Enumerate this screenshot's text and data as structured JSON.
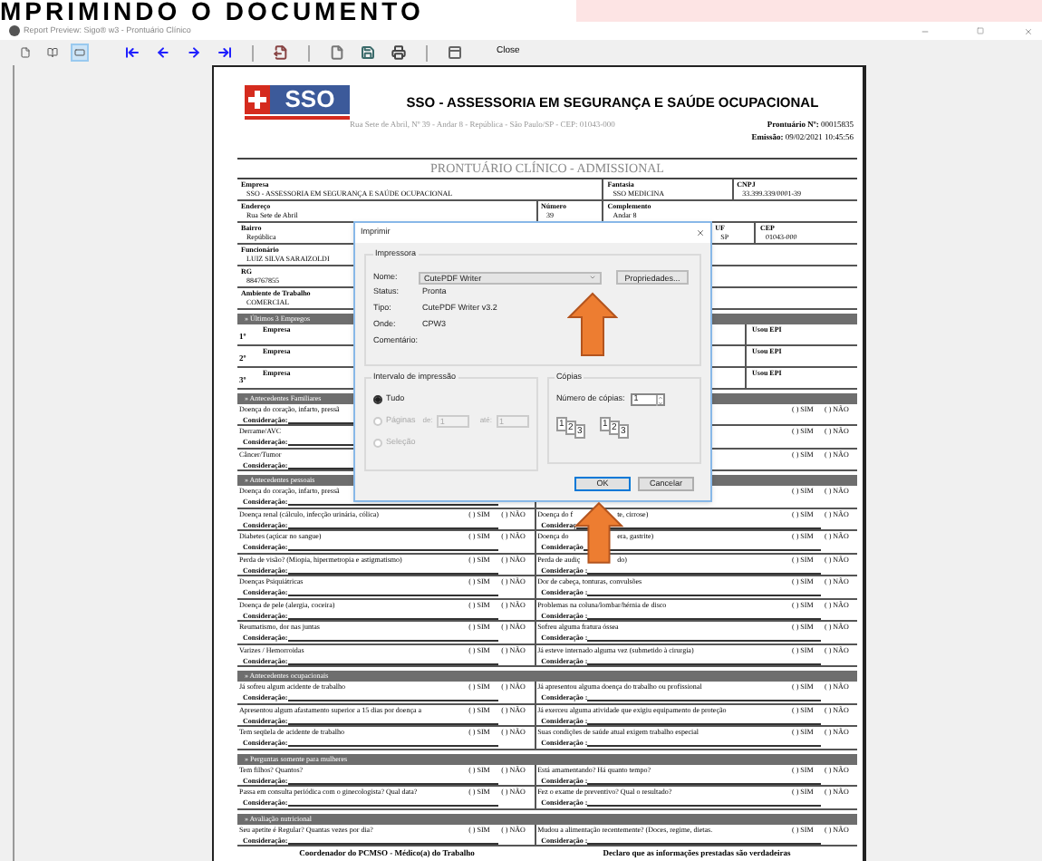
{
  "banner": {
    "text": "MPRIMINDO O DOCUMENTO"
  },
  "window": {
    "title": "Report Preview: Sigo® w3 - Prontuário Clínico"
  },
  "toolbar": {
    "view_modes": [
      {
        "kind": "one-page",
        "selected": false
      },
      {
        "kind": "two-pages",
        "selected": false
      },
      {
        "kind": "page-width",
        "selected": true
      }
    ],
    "tools": [
      {
        "kind": "first"
      },
      {
        "kind": "previous"
      },
      {
        "kind": "next"
      },
      {
        "kind": "last"
      },
      {
        "kind": "separator"
      },
      {
        "kind": "export"
      },
      {
        "kind": "separator"
      },
      {
        "kind": "new"
      },
      {
        "kind": "save"
      },
      {
        "kind": "print"
      },
      {
        "kind": "separator"
      },
      {
        "kind": "panel"
      }
    ],
    "close_label": "Close"
  },
  "document": {
    "logo_text": "SSO",
    "company_title": "SSO - ASSESSORIA EM SEGURANÇA E SAÚDE OCUPACIONAL",
    "address": "Rua Sete de Abril, Nº 39 - Andar 8 - República - São Paulo/SP - CEP: 01043-000",
    "record_label": "Prontuário Nº:",
    "record_no": "00015835",
    "issued_label": "Emissão:",
    "issued": "09/02/2021 10:45:56",
    "title": "PRONTUÁRIO CLÍNICO - ADMISSIONAL",
    "field_rows": [
      [
        {
          "label": "Empresa",
          "value": "SSO - ASSESSORIA EM SEGURANÇA E SAÚDE OCUPACIONAL"
        },
        {
          "label": "Fantasia",
          "value": "SSO MEDICINA"
        },
        {
          "label": "CNPJ",
          "value": "33.399.339/0001-39"
        }
      ],
      [
        {
          "label": "Endereço",
          "value": "Rua Sete de Abril"
        },
        {
          "label": "Número",
          "value": "39"
        },
        {
          "label": "Complemento",
          "value": "Andar 8"
        }
      ],
      [
        {
          "label": "Bairro",
          "value": "República"
        },
        {
          "label": "UF",
          "value": "SP"
        },
        {
          "label": "CEP",
          "value": "01043-000"
        }
      ],
      [
        {
          "label": "Funcionário",
          "value": "LUIZ SILVA SARAIZOLDI"
        }
      ],
      [
        {
          "label": "RG",
          "value": "884767855"
        }
      ],
      [
        {
          "label": "Ambiente de Trabalho",
          "value": "COMERCIAL"
        }
      ]
    ],
    "jobs": {
      "title": "» Últimos 3 Empregos",
      "rows": [
        {
          "index": "1º",
          "company_label": "Empresa",
          "epi_label": "Usou EPI"
        },
        {
          "index": "2º",
          "company_label": "Empresa",
          "epi_label": "Usou EPI"
        },
        {
          "index": "3º",
          "company_label": "Empresa",
          "epi_label": "Usou EPI"
        }
      ]
    },
    "sections": [
      {
        "title": "» Antecedentes Familiares",
        "rows": [
          {
            "left": {
              "question": "Doença do coração, infarto, pressã",
              "note": "Consideração:"
            },
            "right": {
              "yes": "(  ) SIM",
              "no": "(  ) NÃO"
            }
          },
          {
            "left": {
              "question": "Derrame/AVC",
              "note": "Consideração:"
            },
            "right": {
              "yes": "(  ) SIM",
              "no": "(  ) NÃO"
            }
          },
          {
            "left": {
              "question": "Câncer/Tumor",
              "note": "Consideração:"
            },
            "right": {
              "yes": "(  ) SIM",
              "no": "(  ) NÃO"
            }
          }
        ]
      },
      {
        "title": "» Antecedentes pessoais",
        "rows": [
          {
            "left": {
              "question": "Doença do coração, infarto, pressã",
              "note": "Consideração:"
            },
            "right": {
              "yes": "(  ) SIM",
              "no": "(  ) NÃO"
            }
          },
          {
            "left": {
              "question": "Doença renal (cálculo, infecção urinária, cólica)",
              "yes": "(  ) SIM",
              "no": "(  ) NÃO",
              "note": "Consideração:"
            },
            "right": {
              "question": [
                "Doença do f",
                "te, cirrose)"
              ],
              "yes": "(  ) SIM",
              "no": "(  ) NÃO",
              "note": "Consideraç"
            }
          },
          {
            "left": {
              "question": "Diabetes (açúcar no sangue)",
              "yes": "(  ) SIM",
              "no": "(  ) NÃO",
              "note": "Consideração:"
            },
            "right": {
              "question": [
                "Doença do",
                "era, gastrite)"
              ],
              "yes": "(  ) SIM",
              "no": "(  ) NÃO",
              "note": "Consideração"
            }
          },
          {
            "left": {
              "question": "Perda de visão? (Miopia, hipermetropia e astigmatismo)",
              "yes": "(  ) SIM",
              "no": "(  ) NÃO",
              "note": "Consideração:"
            },
            "right": {
              "question": [
                "Perda de audiç",
                "do)"
              ],
              "yes": "(  ) SIM",
              "no": "(  ) NÃO",
              "note": "Consideração :"
            }
          },
          {
            "left": {
              "question": "Doenças Psiquiátricas",
              "yes": "(  ) SIM",
              "no": "(  ) NÃO",
              "note": "Consideração:"
            },
            "right": {
              "question": "Dor de cabeça, tonturas, convulsões",
              "yes": "(  ) SIM",
              "no": "(  ) NÃO",
              "note": "Consideração :"
            }
          },
          {
            "left": {
              "question": "Doença de pele (alergia, coceira)",
              "yes": "(  ) SIM",
              "no": "(  ) NÃO",
              "note": "Consideração:"
            },
            "right": {
              "question": "Problemas na coluna/lombar/hérnia de disco",
              "yes": "(  ) SIM",
              "no": "(  ) NÃO",
              "note": "Consideração :"
            }
          },
          {
            "left": {
              "question": "Reumatismo, dor nas juntas",
              "yes": "(  ) SIM",
              "no": "(  ) NÃO",
              "note": "Consideração:"
            },
            "right": {
              "question": "Sofreu alguma fratura óssea",
              "yes": "(  ) SIM",
              "no": "(  ) NÃO",
              "note": "Consideração :"
            }
          },
          {
            "left": {
              "question": "Varizes / Hemorroidas",
              "yes": "(  ) SIM",
              "no": "(  ) NÃO",
              "note": "Consideração:"
            },
            "right": {
              "question": "Já esteve internado alguma vez (submetido à cirurgia)",
              "yes": "(  ) SIM",
              "no": "(  ) NÃO",
              "note": "Consideração :"
            }
          }
        ]
      },
      {
        "title": "» Antecedentes ocupacionais",
        "rows": [
          {
            "left": {
              "question": "Já sofreu algum acidente de trabalho",
              "yes": "(  ) SIM",
              "no": "(  ) NÃO",
              "note": "Consideração:"
            },
            "right": {
              "question": "Já apresentou alguma doença do trabalho ou profissional",
              "yes": "(  ) SIM",
              "no": "(  ) NÃO",
              "note": "Consideração :"
            }
          },
          {
            "left": {
              "question": "Apresentou algum afastamento superior a 15 dias por doença a",
              "yes": "(  ) SIM",
              "no": "(  ) NÃO",
              "note": "Consideração:"
            },
            "right": {
              "question": "Já exerceu alguma atividade que exigiu equipamento de proteção",
              "yes": "(  ) SIM",
              "no": "(  ) NÃO",
              "note": "Consideração :"
            }
          },
          {
            "left": {
              "question": "Tem seqüela de acidente de trabalho",
              "yes": "(  ) SIM",
              "no": "(  ) NÃO",
              "note": "Consideração:"
            },
            "right": {
              "question": "Suas condições de saúde atual exigem trabalho especial",
              "yes": "(  ) SIM",
              "no": "(  ) NÃO",
              "note": "Consideração :"
            }
          }
        ]
      },
      {
        "title": "» Perguntas somente para mulheres",
        "rows": [
          {
            "left": {
              "question": "Tem filhos? Quantos?",
              "yes": "(  ) SIM",
              "no": "(  ) NÃO",
              "note": "Consideração:"
            },
            "right": {
              "question": "Está amamentando? Há quanto tempo?",
              "yes": "(  ) SIM",
              "no": "(  ) NÃO",
              "note": "Consideração :"
            }
          },
          {
            "left": {
              "question": "Passa em consulta periódica com o ginecologista? Qual data?",
              "yes": "(  ) SIM",
              "no": "(  ) NÃO",
              "note": "Consideração:"
            },
            "right": {
              "question": "Fez o exame de preventivo? Qual o resultado?",
              "yes": "(  ) SIM",
              "no": "(  ) NÃO",
              "note": "Consideração :"
            }
          }
        ]
      },
      {
        "title": "» Avaliação nutricional",
        "rows": [
          {
            "left": {
              "question": "Seu apetite é Regular? Quantas vezes por dia?",
              "yes": "(  ) SIM",
              "no": "(  ) NÃO",
              "note": "Consideração:"
            },
            "right": {
              "question": "Mudou a alimentação recentemente? (Doces, regime, dietas.",
              "yes": "(  ) SIM",
              "no": "(  ) NÃO",
              "note": "Consideração :"
            }
          }
        ]
      }
    ],
    "footer_left": "Coordenador do PCMSO - Médico(a) do Trabalho",
    "footer_right": "Declaro que as informações prestadas são verdadeiras"
  },
  "print_dialog": {
    "title": "Imprimir",
    "printer_group": "Impressora",
    "name_label": "Nome:",
    "printer": "CutePDF Writer",
    "properties": "Propriedades...",
    "info": [
      {
        "label": "Status:",
        "value": "Pronta"
      },
      {
        "label": "Tipo:",
        "value": "CutePDF Writer v3.2"
      },
      {
        "label": "Onde:",
        "value": "CPW3"
      },
      {
        "label": "Comentário:"
      }
    ],
    "range_group": "Intervalo de impressão",
    "range_options": [
      {
        "label": "Tudo",
        "selected": true,
        "disabled": false
      },
      {
        "label": "Páginas",
        "selected": false,
        "disabled": true
      },
      {
        "label": "Seleção",
        "selected": false,
        "disabled": true
      }
    ],
    "from_label": "de:",
    "from": "1",
    "to_label": "até:",
    "to": "1",
    "copies_group": "Cópias",
    "copies_label": "Número de cópias:",
    "copies": "1",
    "collate_icons": [
      [
        "1",
        "2",
        "3"
      ],
      [
        "1",
        "2",
        "3"
      ]
    ],
    "ok": "OK",
    "cancel": "Cancelar"
  }
}
